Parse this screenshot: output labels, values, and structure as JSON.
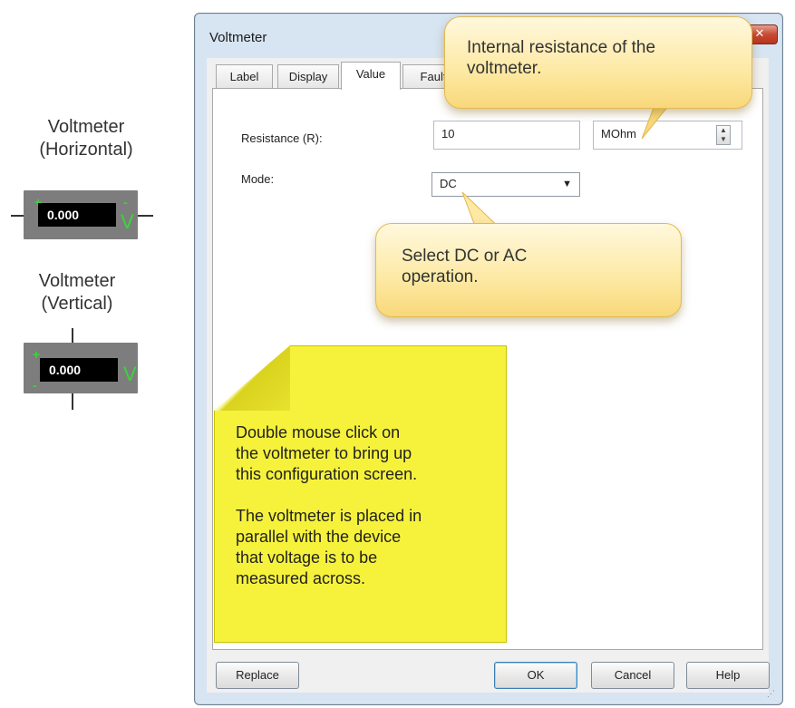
{
  "left_symbols": {
    "horizontal": {
      "title_line1": "Voltmeter",
      "title_line2": "(Horizontal)",
      "reading": "0.000",
      "unit": "V",
      "plus": "+",
      "minus": "-"
    },
    "vertical": {
      "title_line1": "Voltmeter",
      "title_line2": "(Vertical)",
      "reading": "0.000",
      "unit": "V",
      "plus": "+",
      "minus": "-"
    }
  },
  "dialog": {
    "title": "Voltmeter",
    "close_icon": "close-icon",
    "tabs": [
      {
        "label": "Label"
      },
      {
        "label": "Display"
      },
      {
        "label": "Value"
      },
      {
        "label": "Fault"
      }
    ],
    "active_tab": "Value",
    "resistance": {
      "label": "Resistance (R):",
      "value": "10",
      "unit": "MOhm"
    },
    "mode": {
      "label": "Mode:",
      "value": "DC"
    },
    "buttons": {
      "replace": "Replace",
      "ok": "OK",
      "cancel": "Cancel",
      "help": "Help"
    }
  },
  "callouts": {
    "resistance_line1": "Internal resistance of the",
    "resistance_line2": "voltmeter.",
    "mode_line1": "Select DC or AC",
    "mode_line2": "operation."
  },
  "note": {
    "p1_line1": "Double mouse click on",
    "p1_line2": "the voltmeter to bring up",
    "p1_line3": "this configuration screen.",
    "p2_line1": "The voltmeter is placed in",
    "p2_line2": "parallel with the device",
    "p2_line3": "that voltage is to be",
    "p2_line4": "measured across."
  },
  "colors": {
    "meter_green": "#3cd43c",
    "note_yellow": "#f6f23b",
    "callout_fill": "#fde9a3",
    "dialog_frame": "#d7e4f2"
  }
}
